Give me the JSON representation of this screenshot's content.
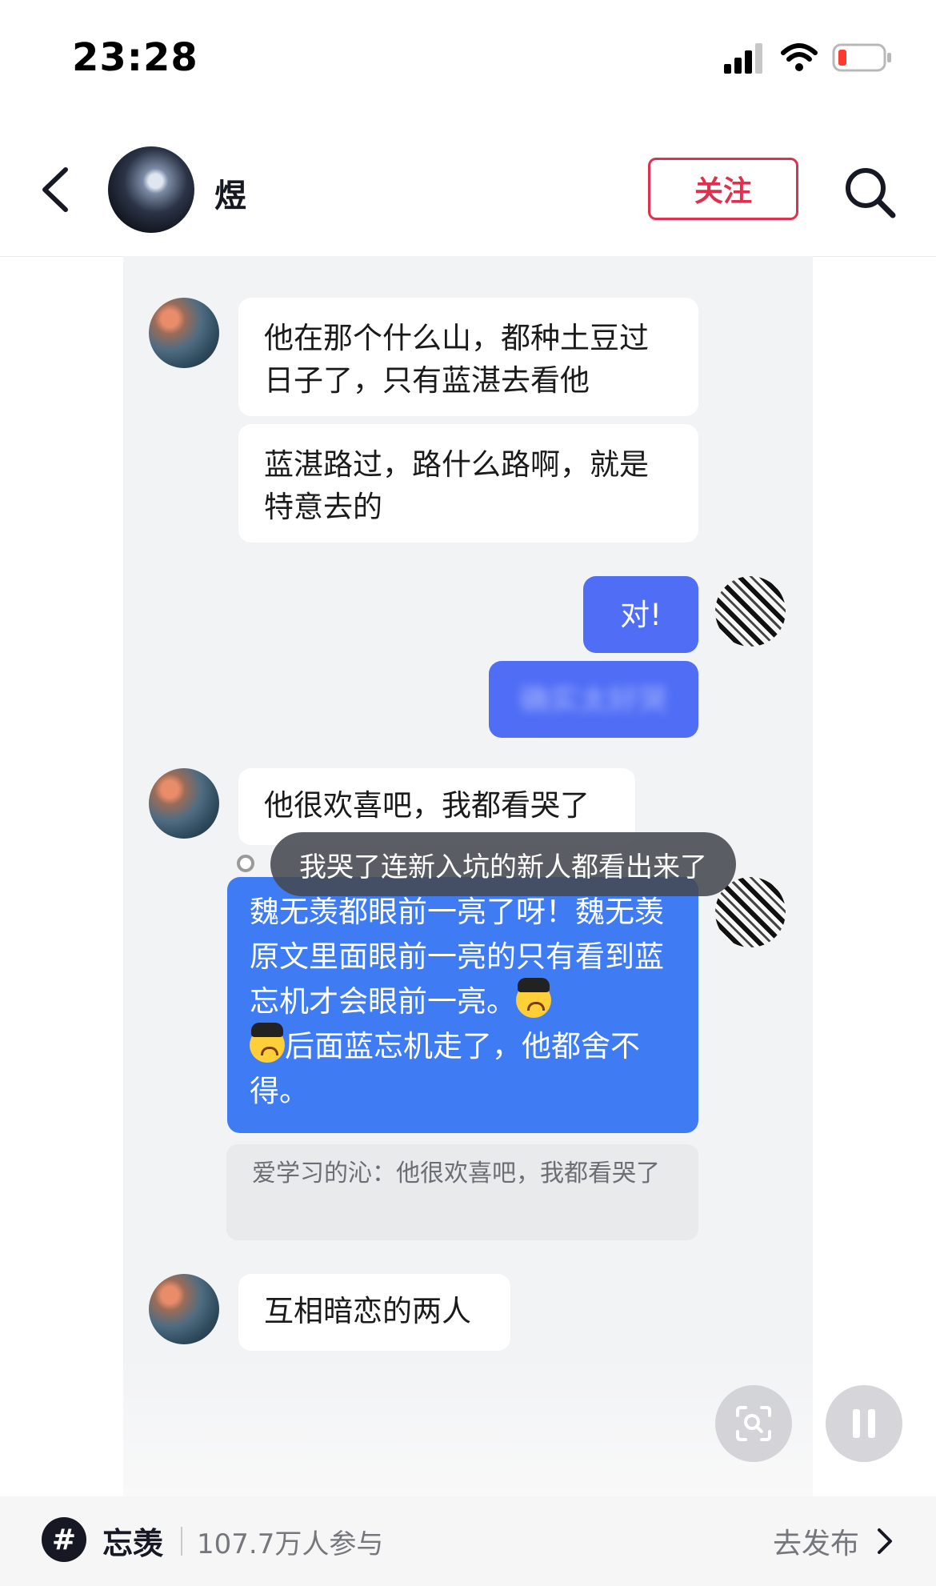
{
  "status_bar": {
    "time": "23:28"
  },
  "header": {
    "name": "煜",
    "follow_label": "关注"
  },
  "chat": {
    "messages_in": [
      "他在那个什么山，都种土豆过日子了，只有蓝湛去看他",
      "蓝湛路过，路什么路啊，就是特意去的"
    ],
    "reply_short": "对!",
    "reply_blurred": "确实太好哭",
    "message_in_3": "他很欢喜吧，我都看哭了",
    "long_reply_1": "魏无羡都眼前一亮了呀！魏无羡原文里面眼前一亮的只有看到蓝忘机才会眼前一亮。",
    "long_reply_2": "后面蓝忘机走了，他都舍不得。",
    "quote": "爱学习的沁：他很欢喜吧，我都看哭了",
    "message_in_4": "互相暗恋的两人"
  },
  "danmaku": "我哭了连新入坑的新人都看出来了",
  "topic_bar": {
    "hashtag": "#",
    "name": "忘羡",
    "count": "107.7万人参与",
    "publish": "去发布"
  },
  "colors": {
    "follow_red": "#e0304e",
    "bubble_blue": "#3f7cf4",
    "chat_bg": "#f2f3f5"
  },
  "icons": [
    "signal-icon",
    "wifi-icon",
    "battery-icon",
    "back-icon",
    "search-icon",
    "scan-icon",
    "pause-icon",
    "chevron-right-icon"
  ]
}
